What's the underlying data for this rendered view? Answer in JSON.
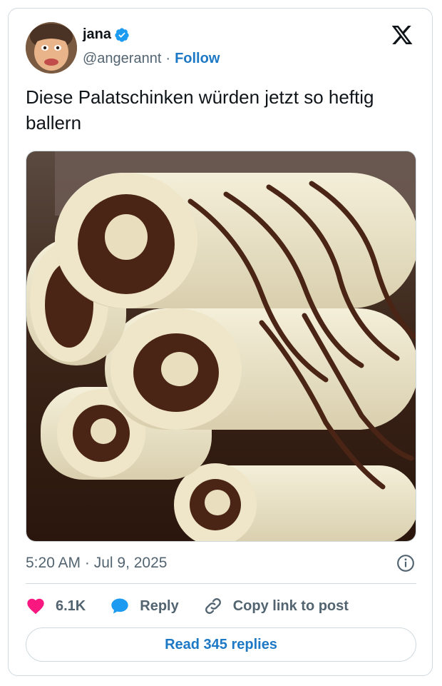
{
  "author": {
    "name": "jana",
    "handle": "@angerannt",
    "separator": "·",
    "follow_label": "Follow",
    "verified_color": "#1d9bf0"
  },
  "tweet": {
    "text": "Diese Palatschinken würden jetzt so heftig ballern",
    "timestamp": "5:20 AM · Jul 9, 2025"
  },
  "actions": {
    "like_count": "6.1K",
    "reply_label": "Reply",
    "copy_label": "Copy link to post"
  },
  "read_replies_label": "Read 345 replies",
  "colors": {
    "accent": "#1d79c5",
    "like": "#f91880",
    "reply": "#1d9bf0",
    "muted": "#536471"
  },
  "icons": [
    "verified-badge-icon",
    "x-logo-icon",
    "info-icon",
    "heart-icon",
    "speech-bubble-icon",
    "link-icon"
  ]
}
